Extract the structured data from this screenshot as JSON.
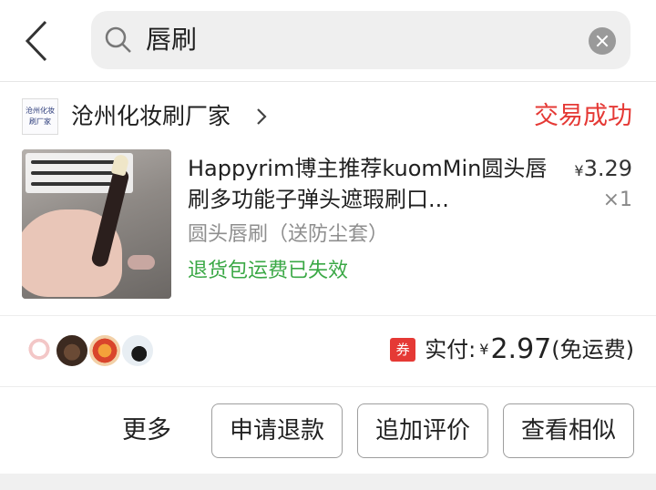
{
  "search": {
    "query": "唇刷"
  },
  "shop": {
    "logo_text_line1": "沧州化妆",
    "logo_text_line2": "刷厂家",
    "name": "沧州化妆刷厂家",
    "status": "交易成功"
  },
  "product": {
    "title": "Happyrim博主推荐kuomMin圆头唇刷多功能子弹头遮瑕刷口...",
    "price_currency": "¥",
    "price_value": "3.29",
    "quantity": "×1",
    "spec": "圆头唇刷（送防尘套）",
    "refund_note": "退货包运费已失效"
  },
  "summary": {
    "coupon_label": "券",
    "paid_label": "实付:",
    "currency": "¥",
    "amount": "2.97",
    "shipping_note": "(免运费)"
  },
  "actions": {
    "more_label": "更多",
    "refund_button": "申请退款",
    "review_button": "追加评价",
    "similar_button": "查看相似"
  },
  "colors": {
    "status_red": "#e53935",
    "refund_green": "#3aa845",
    "coupon_red": "#e53935"
  },
  "icons": [
    "back-arrow-icon",
    "search-icon",
    "clear-icon",
    "chevron-right-icon"
  ]
}
